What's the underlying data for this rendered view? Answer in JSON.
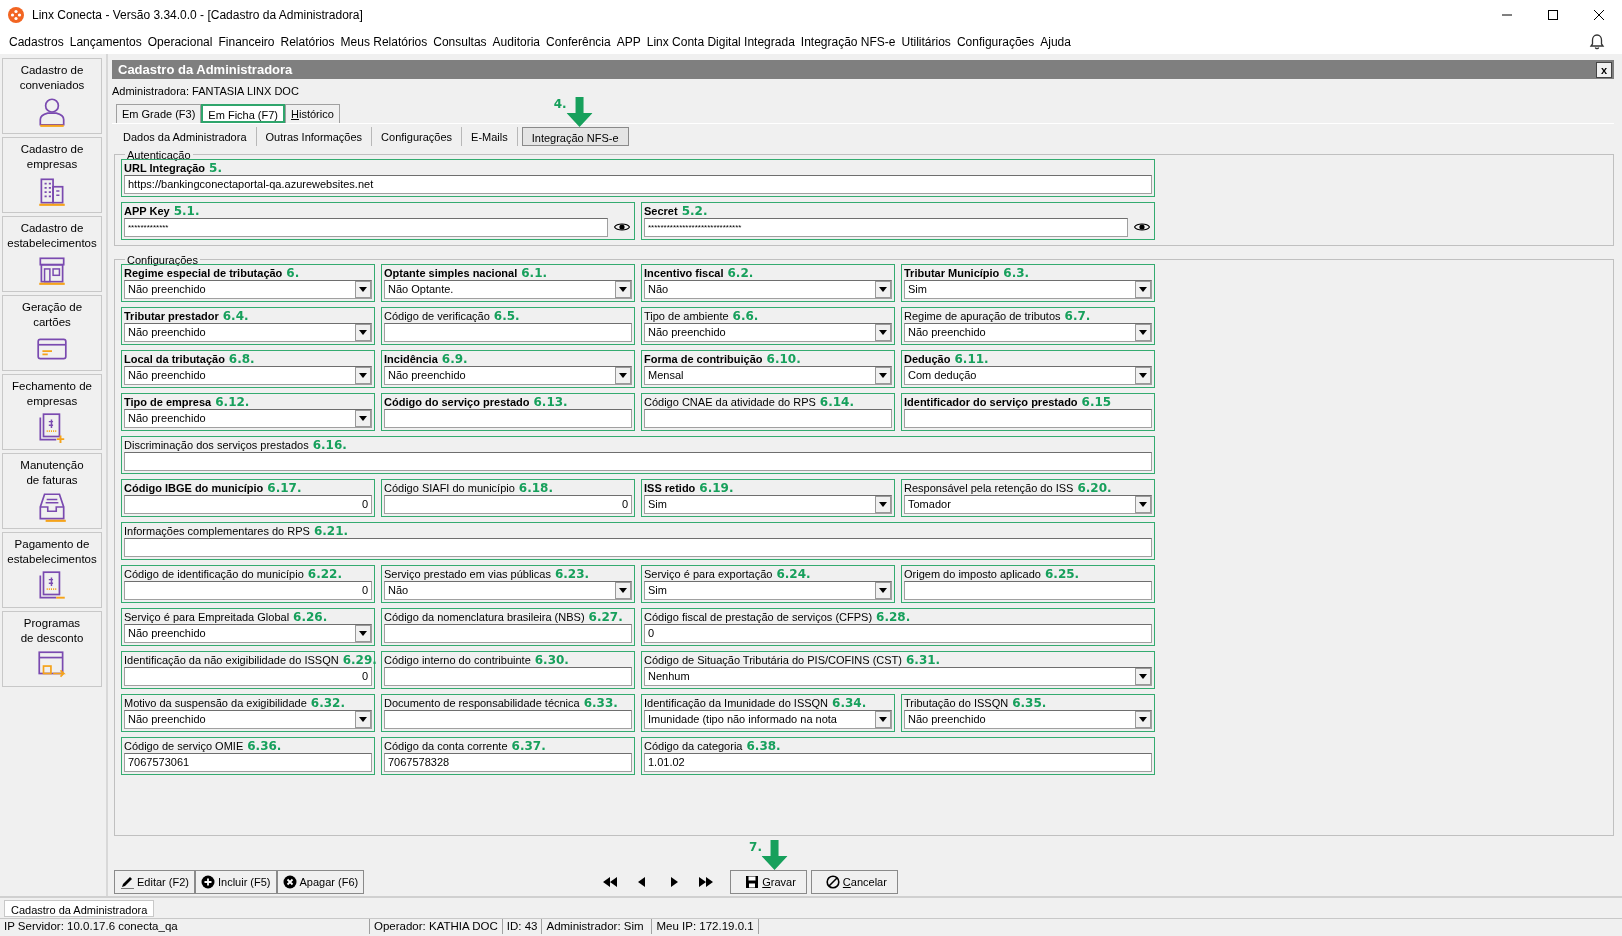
{
  "window": {
    "title": "Linx Conecta - Versão 3.34.0.0 - [Cadastro da Administradora]"
  },
  "menu": [
    "Cadastros",
    "Lançamentos",
    "Operacional",
    "Financeiro",
    "Relatórios",
    "Meus Relatórios",
    "Consultas",
    "Auditoria",
    "Conferência",
    "APP",
    "Linx Conta Digital Integrada",
    "Integração NFS-e",
    "Utilitários",
    "Configurações",
    "Ajuda"
  ],
  "sidebar": [
    {
      "lines": [
        "Cadastro de",
        "conveniados"
      ],
      "kind": "person"
    },
    {
      "lines": [
        "Cadastro de",
        "empresas"
      ],
      "kind": "buildings"
    },
    {
      "lines": [
        "Cadastro de",
        "estabelecimentos"
      ],
      "kind": "store"
    },
    {
      "lines": [
        "Geração de",
        "cartões"
      ],
      "kind": "card"
    },
    {
      "lines": [
        "Fechamento de",
        "empresas"
      ],
      "kind": "invoice_plus"
    },
    {
      "lines": [
        "Manutenção",
        "de faturas"
      ],
      "kind": "tray"
    },
    {
      "lines": [
        "Pagamento de",
        "estabelecimentos"
      ],
      "kind": "invoice_minus"
    },
    {
      "lines": [
        "Programas",
        "de desconto"
      ],
      "kind": "discount"
    }
  ],
  "panel": {
    "title": "Cadastro da Administradora",
    "close": "x",
    "administradora": "Administradora: FANTASIA LINX DOC"
  },
  "view_tabs": [
    {
      "label": "Em Grade (F3)",
      "selected": false
    },
    {
      "label": "Em Ficha (F7)",
      "selected": true
    },
    {
      "label": "Histórico",
      "selected": false,
      "mnemonic": true
    }
  ],
  "section_tabs": [
    {
      "label": "Dados da Administradora",
      "selected": false
    },
    {
      "label": "Outras Informações",
      "selected": false
    },
    {
      "label": "Configurações",
      "selected": false
    },
    {
      "label": "E-Mails",
      "selected": false
    },
    {
      "label": "Integração NFS-e",
      "selected": true,
      "callout": "4."
    }
  ],
  "autenticacao": {
    "title": "Autenticação",
    "rows": [
      [
        {
          "label": "URL Integração",
          "bold": true,
          "callout": "5.",
          "kind": "text",
          "value": "https://bankingconectaportal-qa.azurewebsites.net"
        }
      ],
      [
        {
          "label": "APP Key",
          "bold": true,
          "callout": "5.1.",
          "kind": "password",
          "value": "*************"
        },
        {
          "label": "Secret",
          "bold": true,
          "callout": "5.2.",
          "kind": "password",
          "value": "******************************"
        }
      ]
    ]
  },
  "configuracoes": {
    "title": "Configurações",
    "rows": [
      [
        {
          "label": "Regime especial de tributação",
          "bold": true,
          "callout": "6.",
          "kind": "select",
          "value": "Não preenchido"
        },
        {
          "label": "Optante simples nacional",
          "bold": true,
          "callout": "6.1.",
          "kind": "select",
          "value": "Não Optante."
        },
        {
          "label": "Incentivo fiscal",
          "bold": true,
          "callout": "6.2.",
          "kind": "select",
          "value": "Não"
        },
        {
          "label": "Tributar Município",
          "bold": true,
          "callout": "6.3.",
          "kind": "select",
          "value": "Sim"
        }
      ],
      [
        {
          "label": "Tributar prestador",
          "bold": true,
          "callout": "6.4.",
          "kind": "select",
          "value": "Não preenchido"
        },
        {
          "label": "Código de verificação",
          "bold": false,
          "callout": "6.5.",
          "kind": "text"
        },
        {
          "label": "Tipo de ambiente",
          "bold": false,
          "callout": "6.6.",
          "kind": "select",
          "value": "Não preenchido"
        },
        {
          "label": "Regime de apuração de tributos",
          "bold": false,
          "callout": "6.7.",
          "kind": "select",
          "value": "Não preenchido"
        }
      ],
      [
        {
          "label": "Local da tributação",
          "bold": true,
          "callout": "6.8.",
          "kind": "select",
          "value": "Não preenchido"
        },
        {
          "label": "Incidência",
          "bold": true,
          "callout": "6.9.",
          "kind": "select",
          "value": "Não preenchido"
        },
        {
          "label": "Forma de contribuição",
          "bold": true,
          "callout": "6.10.",
          "kind": "select",
          "value": "Mensal"
        },
        {
          "label": "Dedução",
          "bold": true,
          "callout": "6.11.",
          "kind": "select",
          "value": "Com dedução"
        }
      ],
      [
        {
          "label": "Tipo de empresa",
          "bold": true,
          "callout": "6.12.",
          "kind": "select",
          "value": "Não preenchido"
        },
        {
          "label": "Código do serviço prestado",
          "bold": true,
          "callout": "6.13.",
          "kind": "text"
        },
        {
          "label": "Código CNAE da atividade do RPS",
          "bold": false,
          "callout": "6.14.",
          "kind": "text"
        },
        {
          "label": "Identificador do serviço prestado",
          "bold": true,
          "callout": "6.15",
          "kind": "text"
        }
      ],
      [
        {
          "label": "Discriminação dos serviços prestados",
          "bold": false,
          "callout": "6.16.",
          "kind": "text"
        }
      ],
      [
        {
          "label": "Código IBGE do município",
          "bold": true,
          "callout": "6.17.",
          "kind": "number",
          "value": "0"
        },
        {
          "label": "Código SIAFI do município",
          "bold": false,
          "callout": "6.18.",
          "kind": "number",
          "value": "0"
        },
        {
          "label": "ISS retido",
          "bold": true,
          "callout": "6.19.",
          "kind": "select",
          "value": "Sim"
        },
        {
          "label": "Responsável pela retenção do ISS",
          "bold": false,
          "callout": "6.20.",
          "kind": "select",
          "value": "Tomador"
        }
      ],
      [
        {
          "label": "Informações complementares do RPS",
          "bold": false,
          "callout": "6.21.",
          "kind": "text"
        }
      ],
      [
        {
          "label": "Código de identificação do município",
          "bold": false,
          "callout": "6.22.",
          "kind": "number",
          "value": "0"
        },
        {
          "label": "Serviço prestado em vias públicas",
          "bold": false,
          "callout": "6.23.",
          "kind": "select",
          "value": "Não"
        },
        {
          "label": "Serviço é para exportação",
          "bold": false,
          "callout": "6.24.",
          "kind": "select",
          "value": "Sim"
        },
        {
          "label": "Origem do imposto aplicado",
          "bold": false,
          "callout": "6.25.",
          "kind": "text"
        }
      ],
      [
        {
          "label": "Serviço é para Empreitada Global",
          "bold": false,
          "callout": "6.26.",
          "kind": "select",
          "value": "Não preenchido"
        },
        {
          "label": "Código da nomenclatura brasileira (NBS)",
          "bold": false,
          "callout": "6.27.",
          "kind": "text"
        },
        {
          "label": "Código fiscal de prestação de serviços (CFPS)",
          "bold": false,
          "callout": "6.28.",
          "kind": "text",
          "value": "0"
        }
      ],
      [
        {
          "label": "Identificação da não exigibilidade do ISSQN",
          "bold": false,
          "callout": "6.29.",
          "kind": "number",
          "value": "0"
        },
        {
          "label": "Código interno do contribuinte",
          "bold": false,
          "callout": "6.30.",
          "kind": "text"
        },
        {
          "label": "Código de Situação Tributária do PIS/COFINS (CST)",
          "bold": false,
          "callout": "6.31.",
          "kind": "select",
          "value": "Nenhum"
        }
      ],
      [
        {
          "label": "Motivo da suspensão da exigibilidade",
          "bold": false,
          "callout": "6.32.",
          "kind": "select",
          "value": "Não preenchido"
        },
        {
          "label": "Documento de responsabilidade técnica",
          "bold": false,
          "callout": "6.33.",
          "kind": "text"
        },
        {
          "label": "Identificação da Imunidade do ISSQN",
          "bold": false,
          "callout": "6.34.",
          "kind": "select",
          "value": "Imunidade (tipo não informado na nota"
        },
        {
          "label": "Tributação do ISSQN",
          "bold": false,
          "callout": "6.35.",
          "kind": "select",
          "value": "Não preenchido"
        }
      ],
      [
        {
          "label": "Código de serviço OMIE",
          "bold": false,
          "callout": "6.36.",
          "kind": "text",
          "value": "7067573061"
        },
        {
          "label": "Código da conta corrente",
          "bold": false,
          "callout": "6.37.",
          "kind": "text",
          "value": "7067578328"
        },
        {
          "label": "Código da categoria",
          "bold": false,
          "callout": "6.38.",
          "kind": "text",
          "value": "1.01.02"
        }
      ]
    ]
  },
  "record_buttons": [
    {
      "label": "Editar (F2)",
      "kind": "edit"
    },
    {
      "label": "Incluir (F5)",
      "kind": "add"
    },
    {
      "label": "Apagar (F6)",
      "kind": "delete"
    }
  ],
  "navigation": [
    {
      "kind": "first"
    },
    {
      "kind": "previous"
    },
    {
      "kind": "next"
    },
    {
      "kind": "last"
    }
  ],
  "action_buttons": [
    {
      "label": "Gravar",
      "kind": "save",
      "mnemonic": true,
      "callout": "7."
    },
    {
      "label": "Cancelar",
      "kind": "cancel",
      "mnemonic": true
    }
  ],
  "window_tabs": [
    "Cadastro da Administradora"
  ],
  "status_bar": [
    "IP Servidor: 10.0.17.6 conecta_qa",
    "Operador: KATHIA DOC",
    "ID: 43",
    "Administrador: Sim",
    "Meu IP: 172.19.0.1"
  ]
}
